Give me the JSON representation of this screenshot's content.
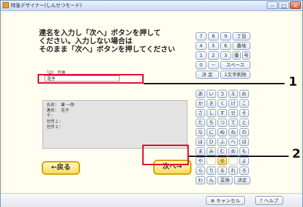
{
  "window": {
    "title": "特急デザイナー(しんせつモード)"
  },
  "instruction": {
    "line1": "連名を入力し「次へ」ボタンを押して",
    "line2": "ください。入力しない場合は",
    "line3": "そのまま「次へ」ボタンを押してください"
  },
  "form": {
    "label1": "「Ω]　可恵",
    "input_value": "花子",
    "label2": "花子"
  },
  "preview": {
    "lines": [
      "氏名：　筆 一郎",
      "連名：　花子",
      "〒：",
      "住所１：",
      "住所２："
    ]
  },
  "buttons": {
    "back": "←戻る",
    "next": "次へ→",
    "cancel": "キャンセル",
    "help": "ヘルプ"
  },
  "keyboard": {
    "numpad": [
      [
        "7",
        "8",
        "9",
        "丁目"
      ],
      [
        "4",
        "5",
        "6",
        "番地"
      ],
      [
        "1",
        "2",
        "3",
        "番",
        "号"
      ],
      [
        "0",
        "－",
        "スペース"
      ]
    ],
    "actions": [
      "決 定",
      "1文字削除"
    ],
    "kana_rows": [
      [
        "あ",
        "い",
        "う",
        "え",
        "お"
      ],
      [
        "か",
        "き",
        "く",
        "け",
        "こ"
      ],
      [
        "さ",
        "し",
        "す",
        "せ",
        "そ"
      ],
      [
        "た",
        "ち",
        "つ",
        "て",
        "と"
      ],
      [
        "な",
        "に",
        "ぬ",
        "ね",
        "の"
      ],
      [
        "は",
        "ひ",
        "ふ",
        "へ",
        "ほ"
      ],
      [
        "ま",
        "み",
        "む",
        "め",
        "も"
      ],
      [
        "や",
        "",
        "ゆ",
        "",
        "よ"
      ],
      [
        "ら",
        "り",
        "る",
        "れ",
        "ろ"
      ]
    ],
    "last_row": [
      "わ",
      "ん",
      "変換",
      "決定"
    ]
  },
  "callouts": [
    "1",
    "2"
  ]
}
